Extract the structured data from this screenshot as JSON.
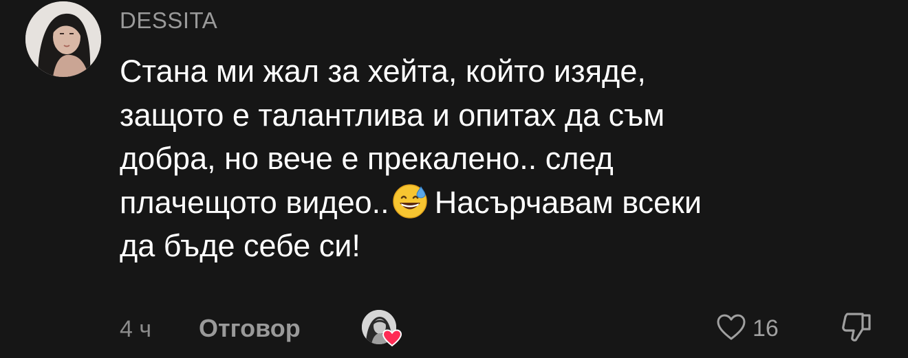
{
  "comment": {
    "username": "DESSITA",
    "text_lines": [
      "Стана ми жал за хейта, който изяде,",
      "защото е талантлива и опитах да съм",
      "добра, но вече е прекалено.. след",
      "плачещото видео..",
      "Насърчавам всеки",
      "да бъде себе си!"
    ],
    "emoji": "grinning-face-with-sweat",
    "time": "4 ч",
    "reply_label": "Отговор",
    "like_count": "16"
  },
  "icons": {
    "avatar": "user-avatar-photo",
    "creator_liked": "creator-liked-heart-icon",
    "like": "heart-outline-icon",
    "dislike": "thumbs-down-outline-icon"
  },
  "colors": {
    "background": "#161616",
    "text": "#ffffff",
    "muted": "#9a9a9a",
    "heart_red": "#fe2c55"
  }
}
